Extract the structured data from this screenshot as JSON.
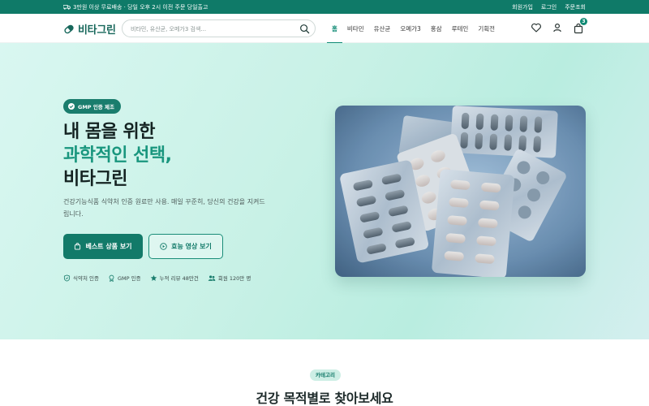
{
  "topbar": {
    "promo": "3만원 이상 무료배송 · 당일 오후 2시 이전 주문 당일출고",
    "links": [
      "회원가입",
      "로그인",
      "주문조회"
    ]
  },
  "header": {
    "logo": "비타그린",
    "search_placeholder": "비타민, 유산균, 오메가3 검색...",
    "nav": [
      {
        "label": "홈",
        "active": true
      },
      {
        "label": "비타민",
        "active": false
      },
      {
        "label": "유산균",
        "active": false
      },
      {
        "label": "오메가3",
        "active": false
      },
      {
        "label": "홍삼",
        "active": false
      },
      {
        "label": "루테인",
        "active": false
      },
      {
        "label": "기획전",
        "active": false
      }
    ],
    "cart_count": "3"
  },
  "hero": {
    "badge": "GMP 인증 제조",
    "headline_line1": "내 몸을 위한",
    "headline_line2": "과학적인 선택,",
    "headline_line3": "비타그린",
    "description": "건강기능식품 식약처 인증 원료만 사용. 매일 꾸준히, 당신의 건강을 지켜드립니다.",
    "primary_button": "베스트 상품 보기",
    "secondary_button": "효능 영상 보기",
    "trust": [
      "식약처 인증",
      "GMP 인증",
      "누적 리뷰 48만건",
      "회원 120만 명"
    ]
  },
  "category": {
    "chip": "카테고리",
    "title": "건강 목적별로 찾아보세요"
  },
  "colors": {
    "brand": "#0f7a68",
    "accent": "#19967e",
    "hero_bg": "#c8f1e6"
  }
}
